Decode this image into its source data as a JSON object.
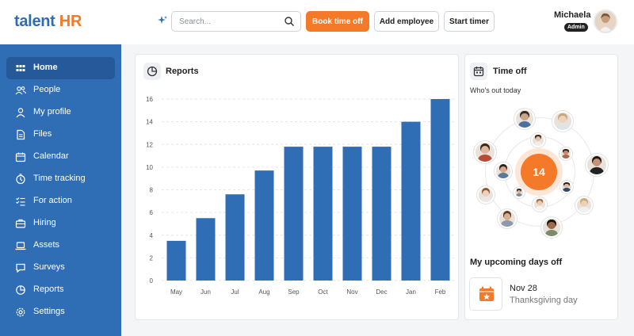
{
  "brand": {
    "name_part1": "talent ",
    "name_part2": "HR",
    "accent": "#2f6db5",
    "orange": "#f47a2a"
  },
  "header": {
    "search_placeholder": "Search...",
    "buttons": {
      "book_time_off": "Book time off",
      "add_employee": "Add employee",
      "start_timer": "Start timer"
    },
    "user": {
      "name": "Michaela",
      "role": "Admin"
    }
  },
  "sidebar": {
    "items": [
      {
        "label": "Home",
        "icon": "grid-icon",
        "active": true
      },
      {
        "label": "People",
        "icon": "people-icon"
      },
      {
        "label": "My profile",
        "icon": "user-icon"
      },
      {
        "label": "Files",
        "icon": "file-icon"
      },
      {
        "label": "Calendar",
        "icon": "calendar-icon"
      },
      {
        "label": "Time tracking",
        "icon": "clock-icon"
      },
      {
        "label": "For action",
        "icon": "checklist-icon"
      },
      {
        "label": "Hiring",
        "icon": "briefcase-icon"
      },
      {
        "label": "Assets",
        "icon": "laptop-icon"
      },
      {
        "label": "Surveys",
        "icon": "chat-icon"
      },
      {
        "label": "Reports",
        "icon": "pie-chart-icon"
      },
      {
        "label": "Settings",
        "icon": "gear-icon"
      }
    ]
  },
  "reports": {
    "title": "Reports"
  },
  "chart_data": {
    "type": "bar",
    "title": "",
    "xlabel": "",
    "ylabel": "",
    "categories": [
      "May",
      "Jun",
      "Jul",
      "Aug",
      "Sep",
      "Oct",
      "Nov",
      "Dec",
      "Jan",
      "Feb"
    ],
    "values": [
      3.5,
      5.5,
      7.6,
      9.7,
      11.8,
      11.8,
      11.8,
      11.8,
      14,
      16
    ],
    "ylim": [
      0,
      16
    ],
    "yticks": [
      "0",
      "2",
      "4",
      "6",
      "8",
      "10",
      "12",
      "14",
      "16"
    ],
    "grid": true,
    "bar_color": "#2f6db5"
  },
  "timeoff": {
    "title": "Time off",
    "subtitle": "Who's out today",
    "count": "14",
    "upcoming_title": "My upcoming days off",
    "upcoming": [
      {
        "date": "Nov 28",
        "name": "Thanksgiving day"
      }
    ]
  }
}
